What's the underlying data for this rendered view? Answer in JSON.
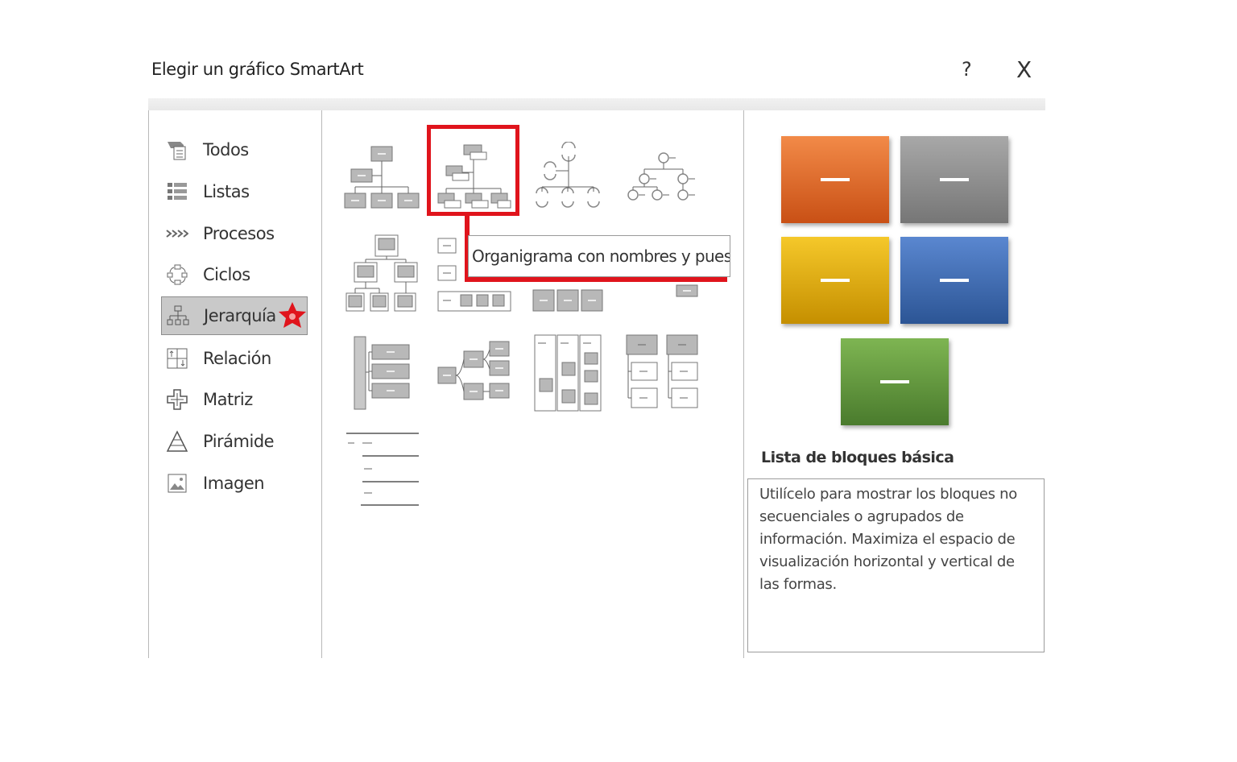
{
  "dialog": {
    "title": "Elegir un gráfico SmartArt",
    "help_label": "?",
    "close_label": "X"
  },
  "sidebar": {
    "items": [
      {
        "label": "Todos",
        "icon": "all-icon"
      },
      {
        "label": "Listas",
        "icon": "list-icon"
      },
      {
        "label": "Procesos",
        "icon": "process-icon"
      },
      {
        "label": "Ciclos",
        "icon": "cycle-icon"
      },
      {
        "label": "Jerarquía",
        "icon": "hierarchy-icon",
        "selected": true
      },
      {
        "label": "Relación",
        "icon": "relationship-icon"
      },
      {
        "label": "Matriz",
        "icon": "matrix-icon"
      },
      {
        "label": "Pirámide",
        "icon": "pyramid-icon"
      },
      {
        "label": "Imagen",
        "icon": "picture-icon"
      }
    ]
  },
  "gallery": {
    "tooltip": "Organigrama con nombres y puestos",
    "highlight_color": "#e0141c"
  },
  "preview": {
    "title": "Lista de bloques básica",
    "description": "Utilícelo para mostrar los bloques no secuenciales o agrupados de información. Maximiza el espacio de visualización horizontal y vertical de las formas.",
    "block_colors": [
      "#e0691f",
      "#8f8f8f",
      "#eab20c",
      "#3a66b0",
      "#5f9a3a"
    ]
  },
  "colors": {
    "accent_red": "#e0141c",
    "selected_bg": "#c9c9c9"
  }
}
